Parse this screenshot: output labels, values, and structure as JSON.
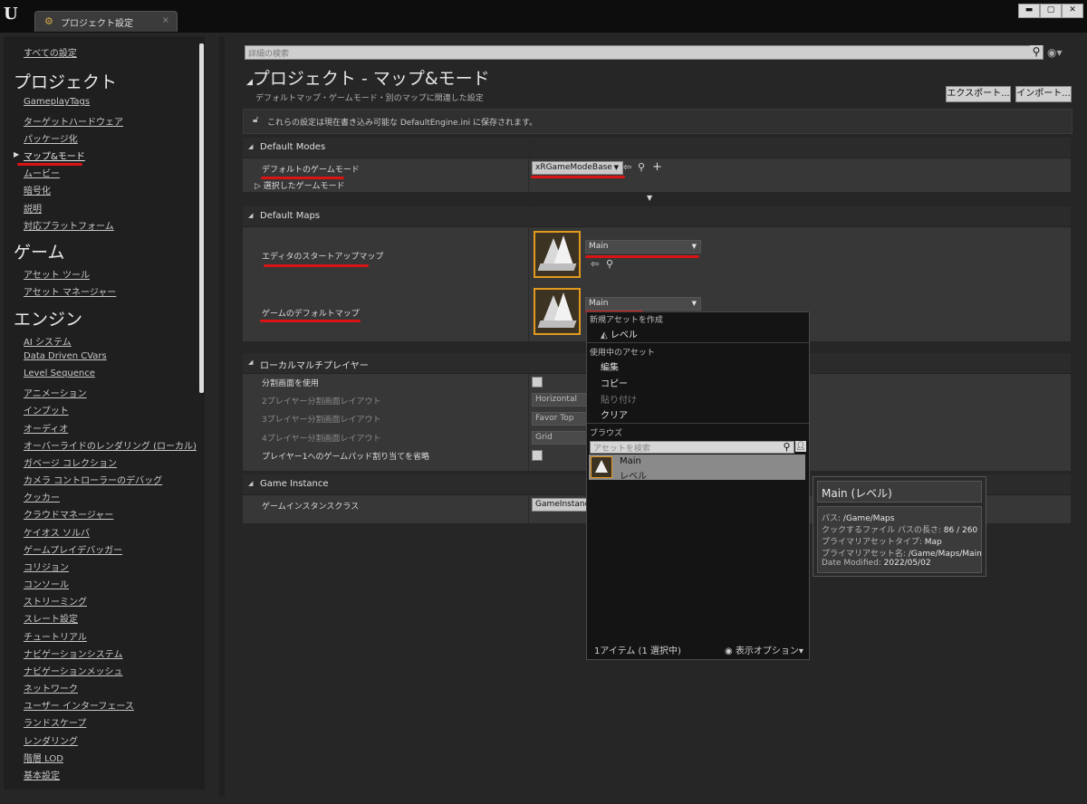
{
  "window": {
    "tab_title": "プロジェクト設定",
    "tab_close": "×",
    "min": "▬",
    "max": "▢",
    "close": "✕"
  },
  "sidebar": {
    "all_settings": "すべての設定",
    "groups": [
      {
        "title": "プロジェクト",
        "items": [
          "GameplayTags",
          "ターゲットハードウェア",
          "パッケージ化",
          "マップ&モード",
          "ムービー",
          "暗号化",
          "説明",
          "対応プラットフォーム"
        ]
      },
      {
        "title": "ゲーム",
        "items": [
          "アセット ツール",
          "アセット マネージャー"
        ]
      },
      {
        "title": "エンジン",
        "items": [
          "AI システム",
          "Data Driven CVars",
          "Level Sequence",
          "アニメーション",
          "インプット",
          "オーディオ",
          "オーバーライドのレンダリング (ローカル)",
          "ガベージ コレクション",
          "カメラ コントローラーのデバッグ",
          "クッカー",
          "クラウドマネージャー",
          "ケイオス ソルバ",
          "ゲームプレイデバッガー",
          "コリジョン",
          "コンソール",
          "ストリーミング",
          "スレート設定",
          "チュートリアル",
          "ナビゲーションシステム",
          "ナビゲーションメッシュ",
          "ネットワーク",
          "ユーザー インターフェース",
          "ランドスケープ",
          "レンダリング",
          "階層 LOD",
          "基本設定"
        ]
      }
    ],
    "active_item": "マップ&モード"
  },
  "main": {
    "search_placeholder": "詳細の検索",
    "title": "プロジェクト - マップ&モード",
    "subtitle": "デフォルトマップ・ゲームモード・別のマップに関連した設定",
    "export_label": "エクスポート...",
    "import_label": "インポート...",
    "info_text": "これらの設定は現在書き込み可能な DefaultEngine.ini に保存されます。",
    "default_modes": {
      "header": "Default Modes",
      "game_mode_label": "デフォルトのゲームモード",
      "game_mode_value": "xRGameModeBase",
      "selected_game_mode": "選択したゲームモード"
    },
    "default_maps": {
      "header": "Default Maps",
      "editor_startup_label": "エディタのスタートアップマップ",
      "editor_startup_value": "Main",
      "game_default_label": "ゲームのデフォルトマップ",
      "game_default_value": "Main"
    },
    "local_multiplayer": {
      "header": "ローカルマルチプレイヤー",
      "split_screen": "分割画面を使用",
      "two_player_label": "2プレイヤー分割画面レイアウト",
      "two_player_value": "Horizontal",
      "three_player_label": "3プレイヤー分割画面レイアウト",
      "three_player_value": "Favor Top",
      "four_player_label": "4プレイヤー分割画面レイアウト",
      "four_player_value": "Grid",
      "skip_gamepad": "プレイヤー1へのゲームパッド割り当てを省略"
    },
    "game_instance": {
      "header": "Game Instance",
      "class_label": "ゲームインスタンスクラス",
      "class_value": "GameInstance"
    }
  },
  "popup": {
    "new_asset_header": "新規アセットを作成",
    "level_item": "レベル",
    "in_use_header": "使用中のアセット",
    "edit": "編集",
    "copy": "コピー",
    "paste": "貼り付け",
    "clear": "クリア",
    "browse_header": "ブラウズ",
    "search_placeholder": "アセットを検索",
    "asset_name": "Main",
    "asset_kind": "レベル",
    "footer": "1アイテム (1 選択中)",
    "view_options": "表示オプション"
  },
  "tooltip": {
    "title": "Main (レベル)",
    "rows": [
      {
        "k": "パス: ",
        "v": "/Game/Maps"
      },
      {
        "k": "クックするファイル パスの長さ: ",
        "v": "86 / 260"
      },
      {
        "k": "プライマリアセットタイプ: ",
        "v": "Map"
      },
      {
        "k": "プライマリアセット名: ",
        "v": "/Game/Maps/Main"
      },
      {
        "k": "Date Modified: ",
        "v": "2022/05/02"
      }
    ]
  },
  "colors": {
    "accent_underline": "#d81414",
    "thumb_border": "#e29a1e"
  }
}
